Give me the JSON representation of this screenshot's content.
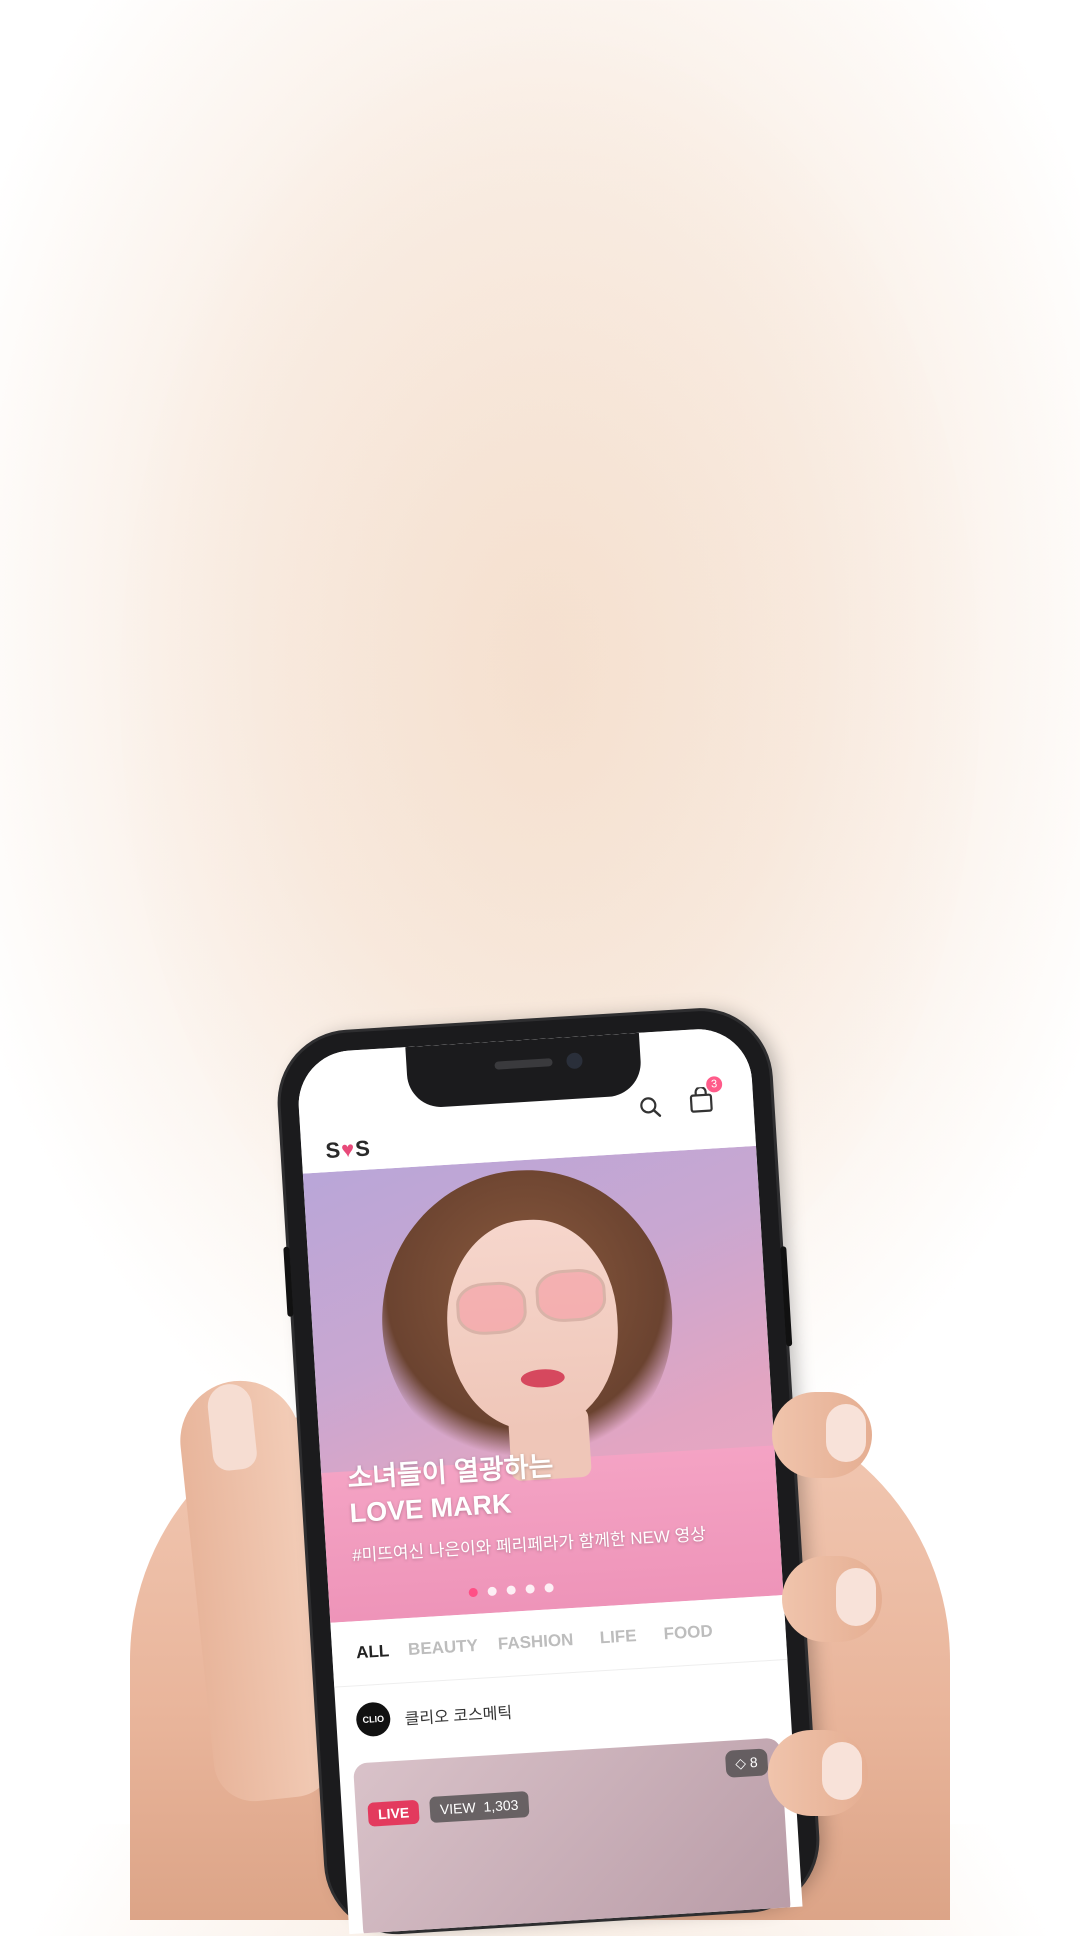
{
  "app": {
    "logo": {
      "text": "S",
      "heart": "♥",
      "text2": "S"
    },
    "cart_badge": "3"
  },
  "hero": {
    "title_line1": "소녀들이 열광하는",
    "title_line2": "LOVE MARK",
    "subtitle": "#미뜨여신 나은이와 페리페라가 함께한 NEW 영상",
    "dots_total": 5,
    "dots_active": 1
  },
  "tabs": [
    {
      "label": "ALL"
    },
    {
      "label": "BEAUTY"
    },
    {
      "label": "FASHION"
    },
    {
      "label": "LIFE"
    },
    {
      "label": "FOOD"
    }
  ],
  "channel": {
    "avatar_text": "CLIO",
    "name": "클리오 코스메틱"
  },
  "video": {
    "live_label": "LIVE",
    "view_label": "VIEW",
    "view_count": "1,303",
    "tag_count": "8"
  },
  "colors": {
    "accent": "#ff4f86",
    "live": "#e33a5e",
    "background": "#f6e4d6"
  }
}
